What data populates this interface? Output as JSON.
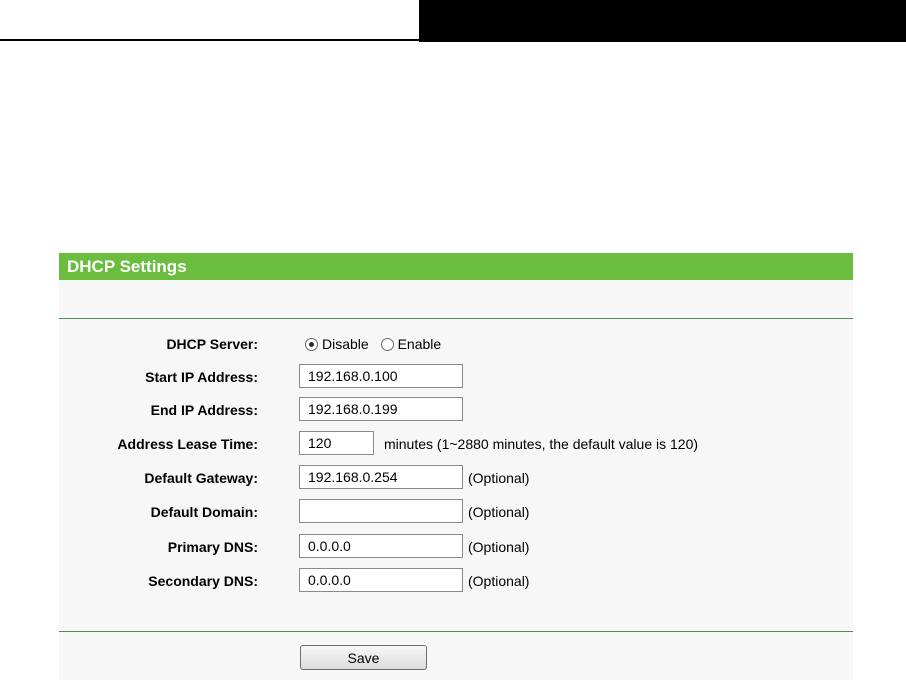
{
  "panel": {
    "title": "DHCP Settings"
  },
  "dhcp_server": {
    "label": "DHCP Server:",
    "options": [
      "Disable",
      "Enable"
    ],
    "selected": "Disable"
  },
  "fields": {
    "start_ip": {
      "label": "Start IP Address:",
      "value": "192.168.0.100"
    },
    "end_ip": {
      "label": "End IP Address:",
      "value": "192.168.0.199"
    },
    "lease_time": {
      "label": "Address Lease Time:",
      "value": "120",
      "hint": "minutes (1~2880 minutes, the default value is 120)"
    },
    "gateway": {
      "label": "Default Gateway:",
      "value": "192.168.0.254",
      "hint": "(Optional)"
    },
    "domain": {
      "label": "Default Domain:",
      "value": "",
      "hint": "(Optional)"
    },
    "primary_dns": {
      "label": "Primary DNS:",
      "value": "0.0.0.0",
      "hint": "(Optional)"
    },
    "secondary_dns": {
      "label": "Secondary DNS:",
      "value": "0.0.0.0",
      "hint": "(Optional)"
    }
  },
  "actions": {
    "save_label": "Save"
  },
  "colors": {
    "header_green": "#6bbd3f",
    "rule_green": "#4f8a5b"
  }
}
